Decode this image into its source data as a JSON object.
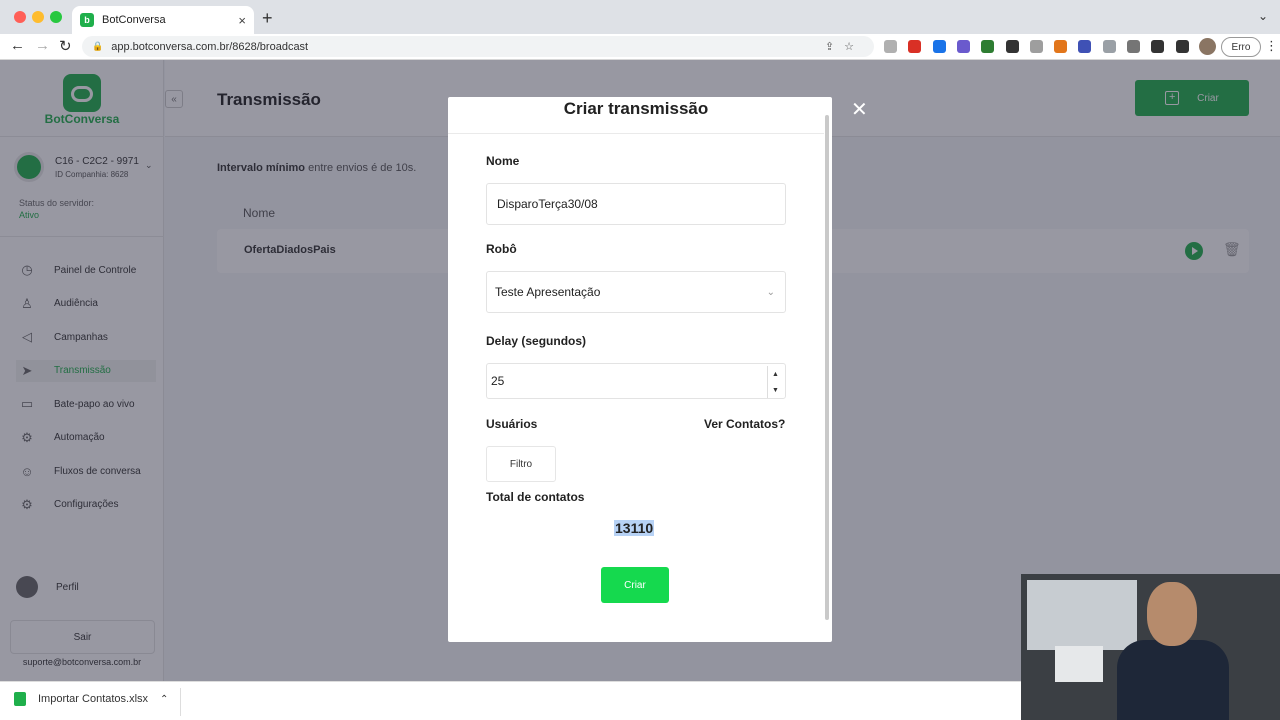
{
  "browser": {
    "tab_title": "BotConversa",
    "tab_close": "×",
    "new_tab": "+",
    "url": "app.botconversa.com.br/8628/broadcast",
    "error_label": "Erro",
    "traffic_colors": [
      "#ff5f57",
      "#febc2e",
      "#28c840"
    ],
    "extension_colors": [
      "#b0b0b0",
      "#d93025",
      "#1a73e8",
      "#6a5acd",
      "#2e7d32",
      "#333333",
      "#9e9e9e",
      "#e2761b",
      "#3f51b5",
      "#9aa0a6",
      "#757575",
      "#333333",
      "#333333"
    ]
  },
  "sidebar": {
    "brand": "BotConversa",
    "company_name": "C16 - C2C2 - 9971",
    "company_id": "ID Companhia: 8628",
    "server_status_label": "Status do servidor:",
    "server_status_value": "Ativo",
    "items": [
      {
        "label": "Painel de Controle",
        "icon": "dashboard-icon",
        "glyph": "◷"
      },
      {
        "label": "Audiência",
        "icon": "audience-icon",
        "glyph": "♙"
      },
      {
        "label": "Campanhas",
        "icon": "megaphone-icon",
        "glyph": "◁"
      },
      {
        "label": "Transmissão",
        "icon": "send-icon",
        "glyph": "➤"
      },
      {
        "label": "Bate-papo ao vivo",
        "icon": "chat-icon",
        "glyph": "▭"
      },
      {
        "label": "Automação",
        "icon": "automation-icon",
        "glyph": "⚙"
      },
      {
        "label": "Fluxos de conversa",
        "icon": "bot-icon",
        "glyph": "☺"
      },
      {
        "label": "Configurações",
        "icon": "gear-icon",
        "glyph": "⚙"
      }
    ],
    "profile_label": "Perfil",
    "logout_label": "Sair",
    "support_email": "suporte@botconversa.com.br"
  },
  "main": {
    "title": "Transmissão",
    "create_label": "Criar",
    "interval_bold": "Intervalo mínimo",
    "interval_rest": " entre envios é de 10s.",
    "column_name": "Nome",
    "rows": [
      {
        "name": "OfertaDiadosPais"
      }
    ]
  },
  "modal": {
    "title": "Criar transmissão",
    "name_label": "Nome",
    "name_value": "DisparoTerça30/08",
    "robot_label": "Robô",
    "robot_value": "Teste Apresentação",
    "delay_label": "Delay (segundos)",
    "delay_value": "25",
    "users_label": "Usuários",
    "view_contacts": "Ver Contatos?",
    "filter_label": "Filtro",
    "total_label": "Total de contatos",
    "total_value": "13110",
    "create_label": "Criar"
  },
  "downloads": {
    "file_name": "Importar Contatos.xlsx"
  },
  "colors": {
    "brand_green": "#1faf4b",
    "button_green": "#15d94e"
  }
}
